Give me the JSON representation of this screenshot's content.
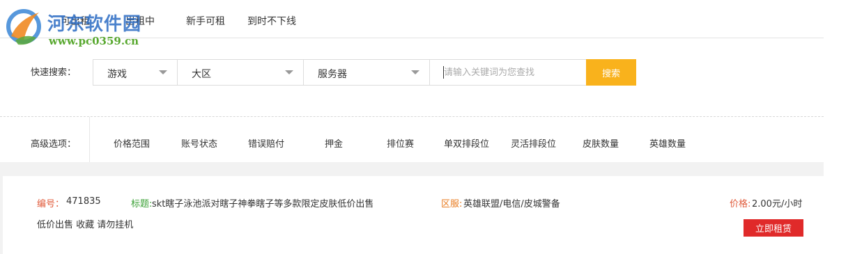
{
  "watermark": {
    "title": "河东软件园",
    "url": "www.pc0359.cn"
  },
  "tabs": [
    {
      "label": "可出租"
    },
    {
      "label": "出租中"
    },
    {
      "label": "新手可租"
    },
    {
      "label": "到时不下线"
    }
  ],
  "search": {
    "label": "快速搜索：",
    "game_select": "游戏",
    "region_select": "大区",
    "server_select": "服务器",
    "keyword_placeholder": "请输入关键词为您查找",
    "keyword_value": "",
    "button_label": "搜索"
  },
  "advanced": {
    "label": "高级选项：",
    "options": [
      "价格范围",
      "账号状态",
      "错误赔付",
      "押金",
      "排位赛",
      "单双排段位",
      "灵活排段位",
      "皮肤数量",
      "英雄数量"
    ]
  },
  "listing": {
    "id_label": "编号：",
    "id_value": "471835",
    "title_label": "标题:",
    "title_value": "skt瞎子泳池派对瞎子神拳瞎子等多款限定皮肤低价出售",
    "region_label": "区服:",
    "region_value": "英雄联盟/电信/皮城警备",
    "price_label": "价格:",
    "price_value": "2.00元/小时",
    "description": "低价出售 收藏 请勿挂机",
    "rent_button": "立即租赁"
  },
  "colors": {
    "accent_search": "#f9b21c",
    "rent_button": "#e02a2a",
    "id_label": "#e05a3a",
    "title_label": "#3aa035",
    "region_label": "#e87a1e"
  },
  "icons": [
    "caret-down-icon",
    "watermark-logo-icon"
  ]
}
